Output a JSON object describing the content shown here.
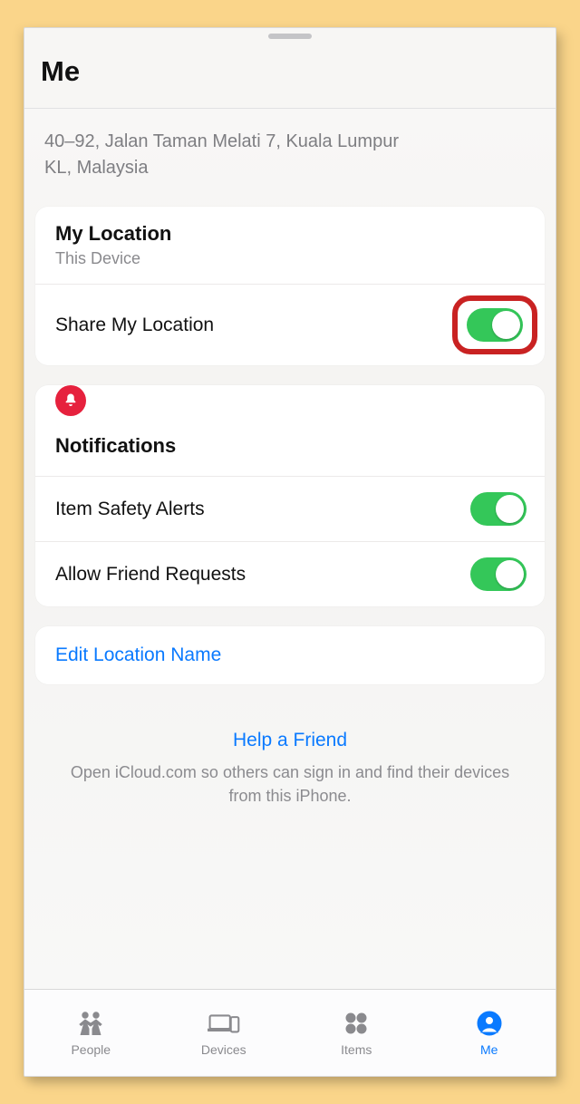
{
  "header": {
    "title": "Me"
  },
  "address": {
    "line1": "40–92, Jalan Taman Melati 7, Kuala Lumpur",
    "line2": "KL, Malaysia"
  },
  "location_card": {
    "my_location_title": "My Location",
    "my_location_sub": "This Device",
    "share_label": "Share My Location",
    "share_on": true
  },
  "notifications_card": {
    "section_title": "Notifications",
    "item_safety_label": "Item Safety Alerts",
    "item_safety_on": true,
    "friend_requests_label": "Allow Friend Requests",
    "friend_requests_on": true
  },
  "edit_card": {
    "edit_label": "Edit Location Name"
  },
  "help": {
    "link": "Help a Friend",
    "sub": "Open iCloud.com so others can sign in and find their devices from this iPhone."
  },
  "tabs": {
    "people": "People",
    "devices": "Devices",
    "items": "Items",
    "me": "Me"
  },
  "colors": {
    "accent": "#0a7aff",
    "toggle_on": "#34c759",
    "danger": "#e6213d",
    "highlight_border": "#c92222"
  }
}
